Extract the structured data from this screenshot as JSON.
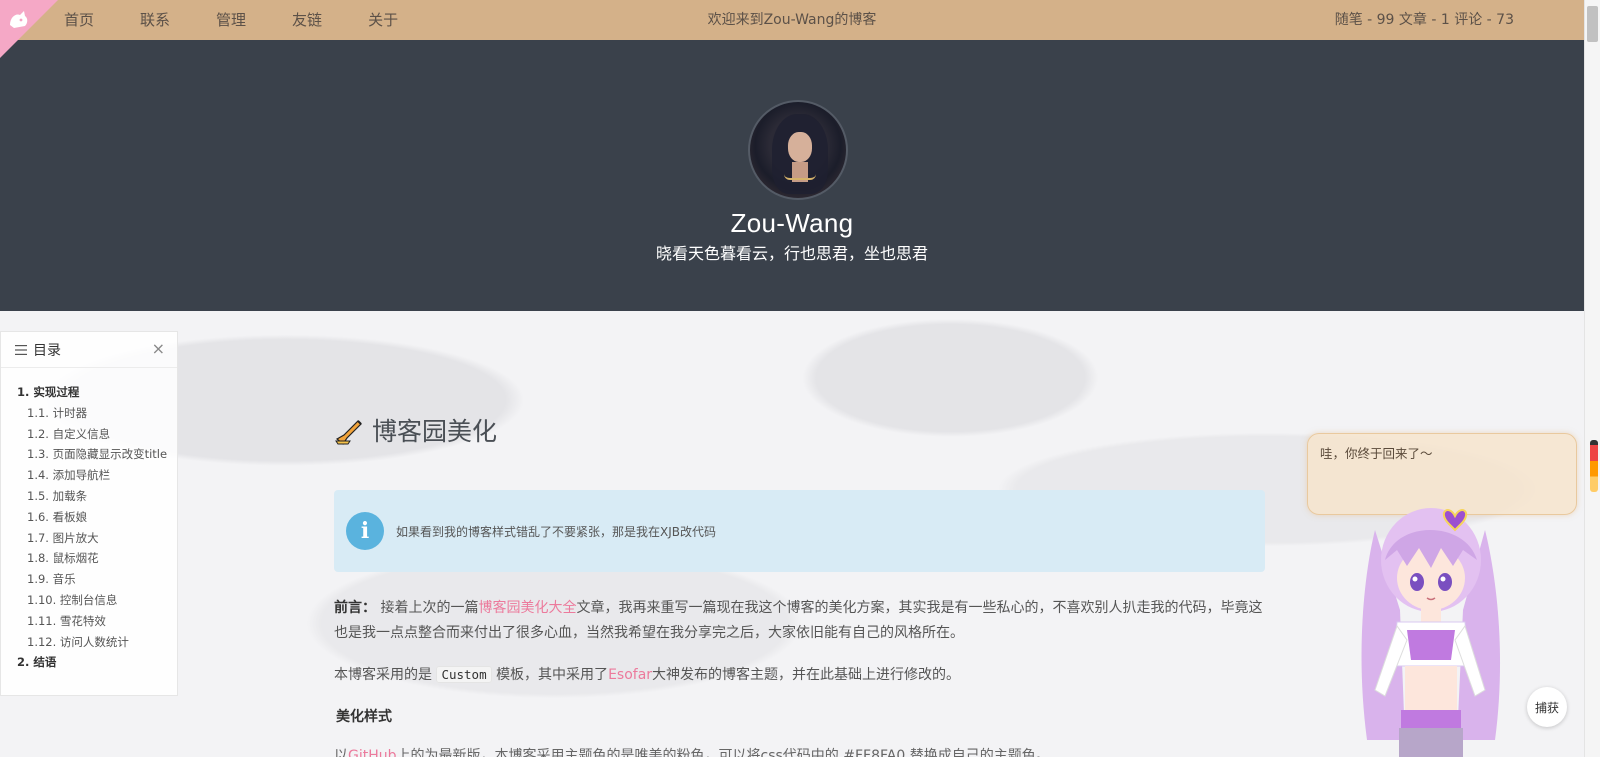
{
  "nav": {
    "links": [
      "首页",
      "联系",
      "管理",
      "友链",
      "关于"
    ],
    "welcome": "欢迎来到Zou-Wang的博客",
    "stats": "随笔 - 99  文章 - 1  评论 - 73"
  },
  "header": {
    "author": "Zou-Wang",
    "motto": "晓看天色暮看云，行也思君，坐也思君"
  },
  "toc": {
    "title": "目录",
    "items": [
      {
        "label": "1. 实现过程",
        "level": 1
      },
      {
        "label": "1.1. 计时器",
        "level": 2
      },
      {
        "label": "1.2. 自定义信息",
        "level": 2
      },
      {
        "label": "1.3. 页面隐藏显示改变title",
        "level": 2
      },
      {
        "label": "1.4. 添加导航栏",
        "level": 2
      },
      {
        "label": "1.5. 加载条",
        "level": 2
      },
      {
        "label": "1.6. 看板娘",
        "level": 2
      },
      {
        "label": "1.7. 图片放大",
        "level": 2
      },
      {
        "label": "1.8. 鼠标烟花",
        "level": 2
      },
      {
        "label": "1.9. 音乐",
        "level": 2
      },
      {
        "label": "1.10. 控制台信息",
        "level": 2
      },
      {
        "label": "1.11. 雪花特效",
        "level": 2
      },
      {
        "label": "1.12. 访问人数统计",
        "level": 2
      },
      {
        "label": "2. 结语",
        "level": 1
      }
    ]
  },
  "post": {
    "title": "博客园美化",
    "notice": "如果看到我的博客样式错乱了不要紧张，那是我在XJB改代码",
    "para1": {
      "lead": "前言：",
      "before_link": "接着上次的一篇",
      "link": "博客园美化大全",
      "after_link": "文章，我再来重写一篇现在我这个博客的美化方案，其实我是有一些私心的，不喜欢别人扒走我的代码，毕竟这也是我一点点整合而来付出了很多心血，当然我希望在我分享完之后，大家依旧能有自己的风格所在。"
    },
    "para2": {
      "before_code": "本博客采用的是",
      "code": "Custom",
      "middle": "模板，其中采用了",
      "link": "Esofar",
      "after_link": "大神发布的博客主题，并在此基础上进行修改的。"
    },
    "section": "美化样式",
    "para3": {
      "before_link": "以",
      "link": "GitHub",
      "after_link": "上的为最新版，本博客采用主题色的是唯美的粉色，可以将css代码中的 #FF8FA0 替换成自己的主题色。"
    }
  },
  "mascot": {
    "speech": "哇，你终于回来了～",
    "capture_button": "捕获"
  },
  "colors": {
    "nav_bg": "#d4b189",
    "hero_bg": "#3a414b",
    "accent_link": "#ec7a9c",
    "notice_bg": "#d8ebf5"
  }
}
